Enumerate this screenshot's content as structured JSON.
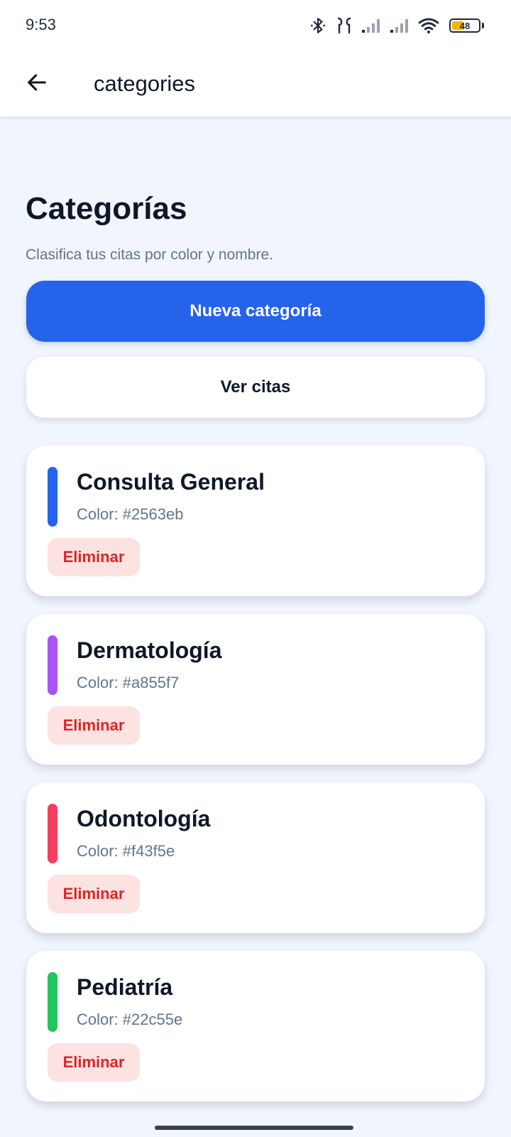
{
  "status_bar": {
    "time": "9:53",
    "battery_level": "48",
    "icons": [
      "bluetooth-icon",
      "earbuds-icon",
      "signal-icon",
      "signal-icon",
      "wifi-icon",
      "battery-icon"
    ]
  },
  "app_bar": {
    "back_icon": "arrow-left-icon",
    "title": "categories"
  },
  "header": {
    "title": "Categorías",
    "subtitle": "Clasifica tus citas por color y nombre."
  },
  "actions": {
    "new_category_label": "Nueva categoría",
    "view_appointments_label": "Ver citas"
  },
  "categories": [
    {
      "name": "Consulta General",
      "color_label": "Color: #2563eb",
      "color": "#2563eb",
      "delete_label": "Eliminar"
    },
    {
      "name": "Dermatología",
      "color_label": "Color: #a855f7",
      "color": "#a855f7",
      "delete_label": "Eliminar"
    },
    {
      "name": "Odontología",
      "color_label": "Color: #f43f5e",
      "color": "#f43f5e",
      "delete_label": "Eliminar"
    },
    {
      "name": "Pediatría",
      "color_label": "Color: #22c55e",
      "color": "#22c55e",
      "delete_label": "Eliminar"
    }
  ],
  "colors": {
    "primary": "#2563eb",
    "background": "#f1f5fd",
    "danger": "#dc2626",
    "danger_bg": "#fde2e2"
  }
}
